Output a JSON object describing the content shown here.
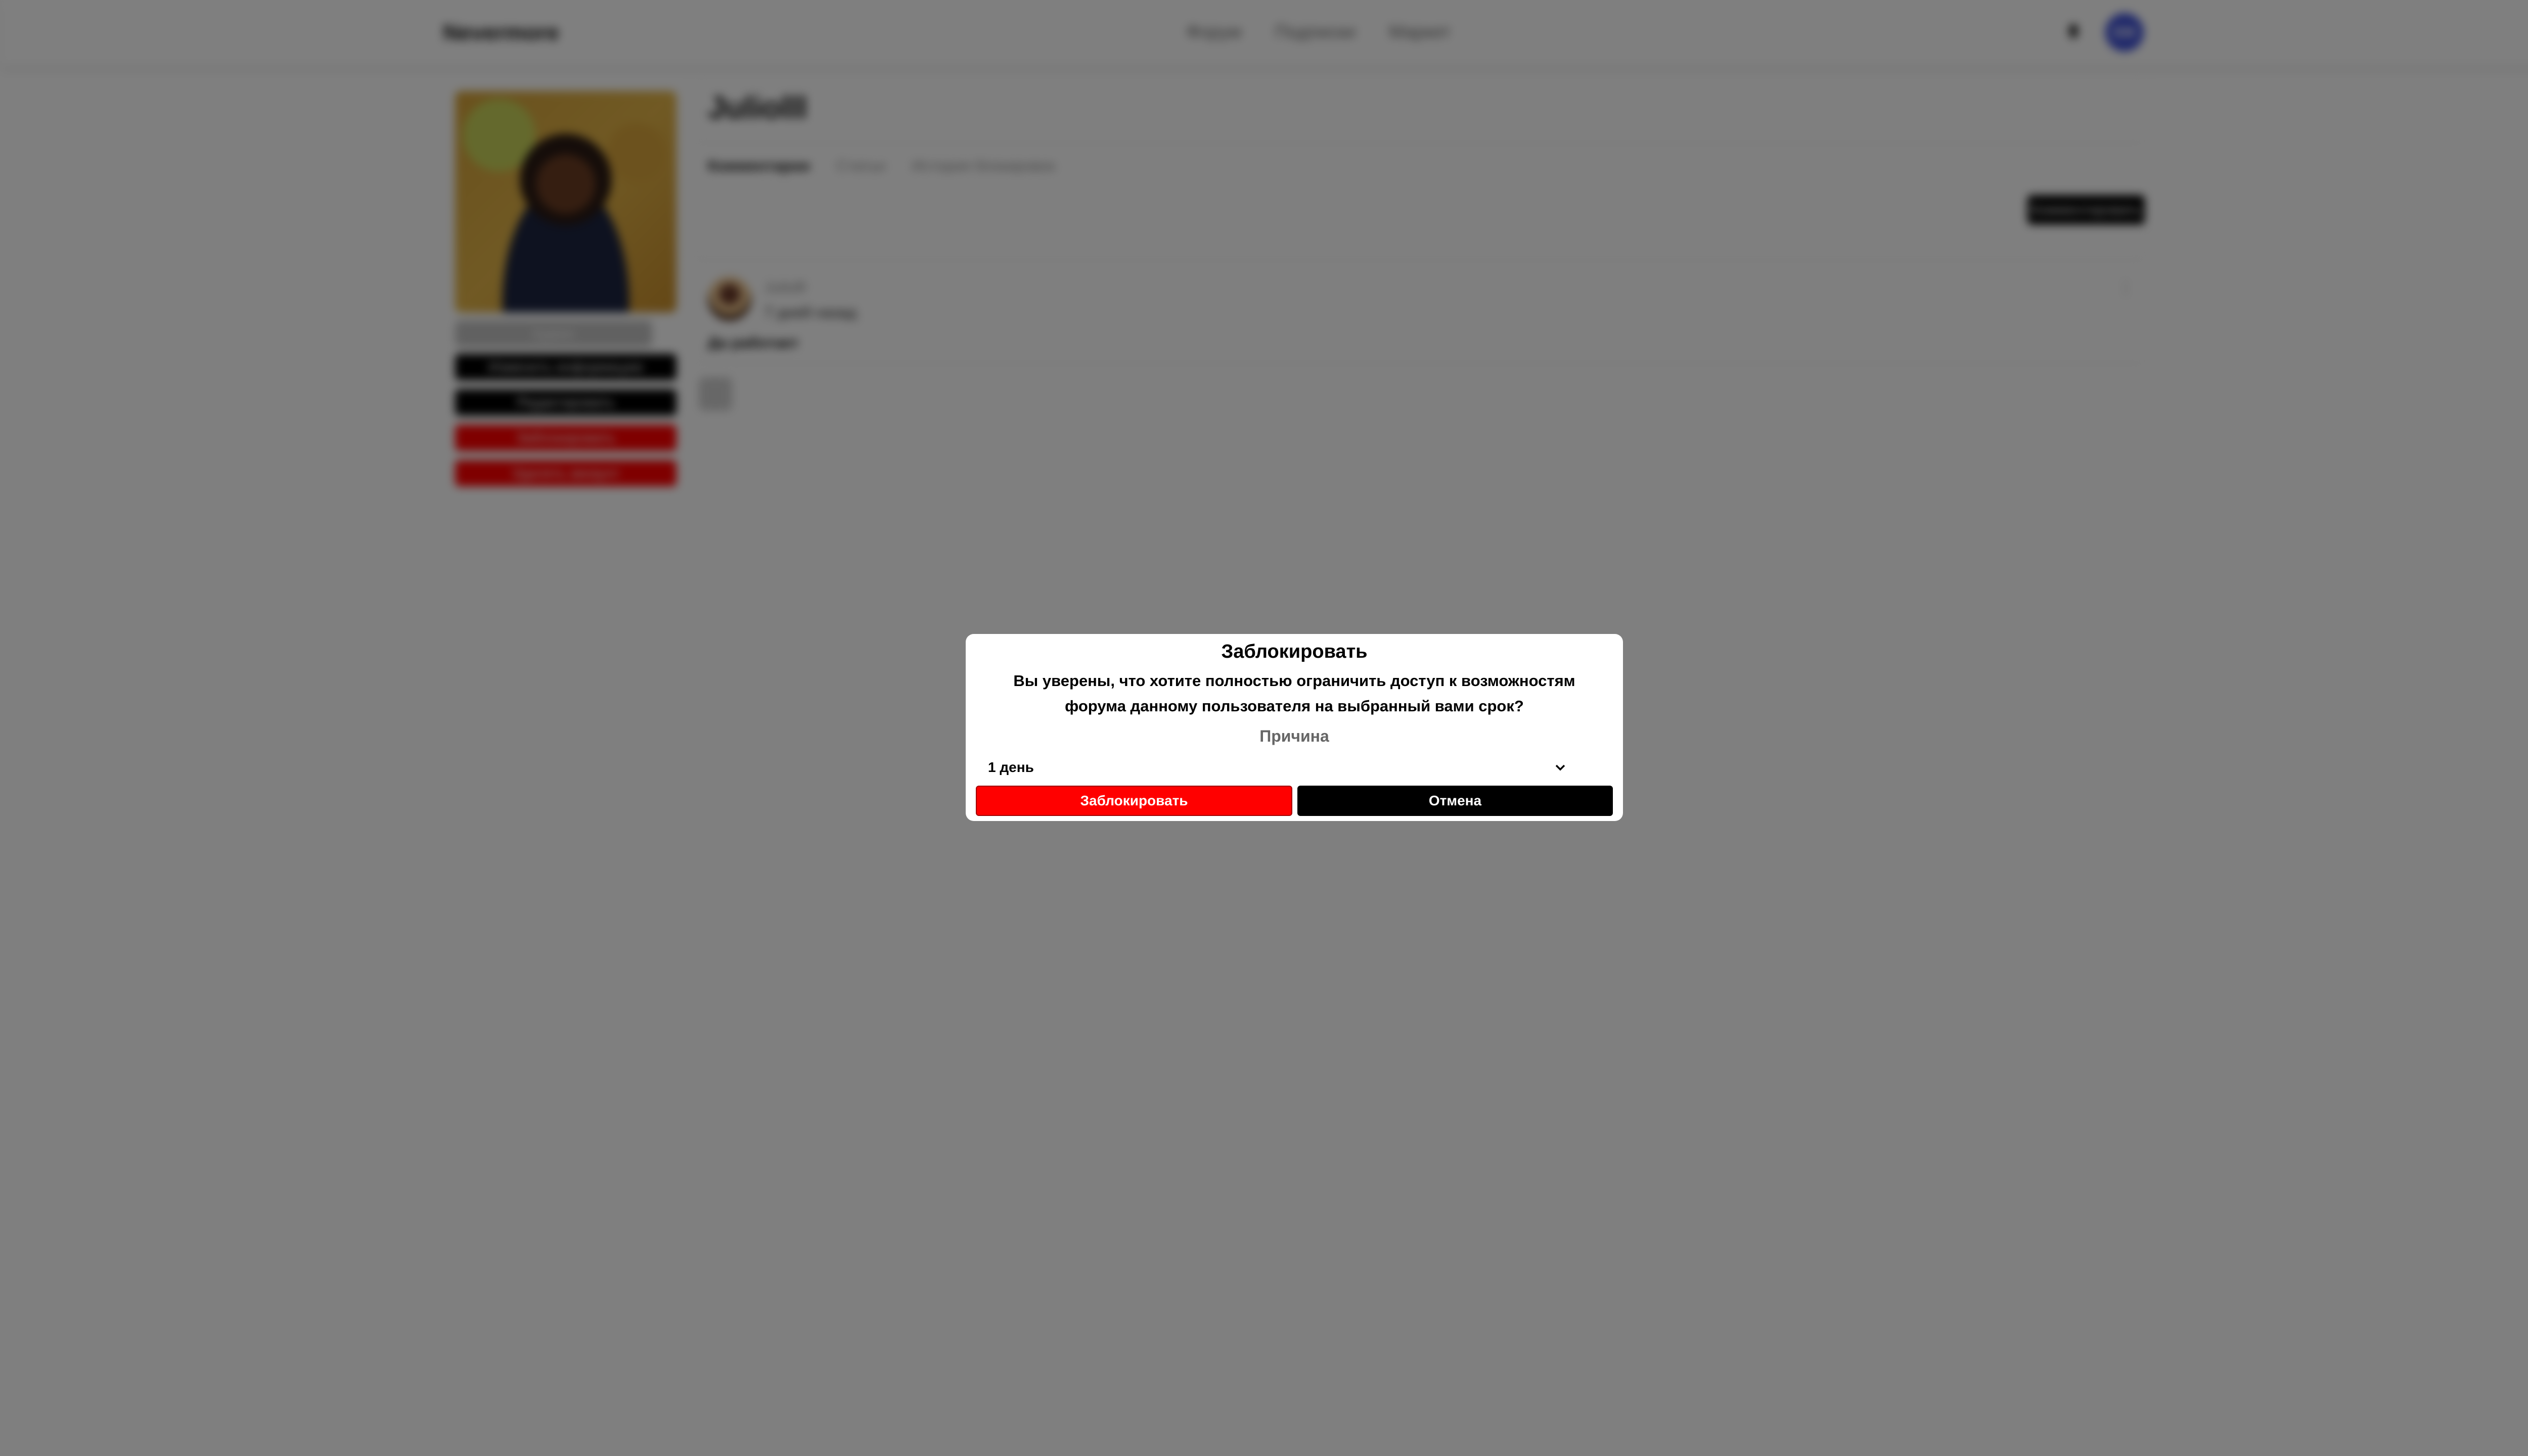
{
  "header": {
    "logo": "Nevermore",
    "nav": [
      "Форум",
      "Подписки",
      "Маркет"
    ],
    "avatar_initials": "ЕМ"
  },
  "profile": {
    "role": "Админ",
    "buttons": {
      "change_info": "Изменить информацию",
      "edit": "Редактировать",
      "block": "Заблокировать",
      "delete": "Удалить аккаунт"
    },
    "username": "Juliolll",
    "tabs": [
      "Комментарии",
      "Статьи",
      "История блокировок"
    ],
    "active_tab": "Комментарии",
    "send_button": "Комментировать"
  },
  "comment": {
    "author": "Juliolll",
    "time": "7 дней назад",
    "text": "Да работает",
    "menu": "⋮"
  },
  "modal": {
    "title": "Заблокировать",
    "question": "Вы уверены, что хотите полностью ограничить доступ к возможностям форума данному пользователя на выбранный вами срок?",
    "reason_label": "Причина",
    "duration_value": "1 день",
    "confirm_label": "Заблокировать",
    "cancel_label": "Отмена"
  },
  "colors": {
    "danger": "#ff0000",
    "dark": "#000000",
    "overlay": "rgba(0,0,0,0.5)",
    "avatar_bg": "#3f51d6"
  },
  "icons": {
    "bell": "bell-icon",
    "chevron": "chevron-down-icon",
    "comment_menu": "more-vertical-icon"
  }
}
